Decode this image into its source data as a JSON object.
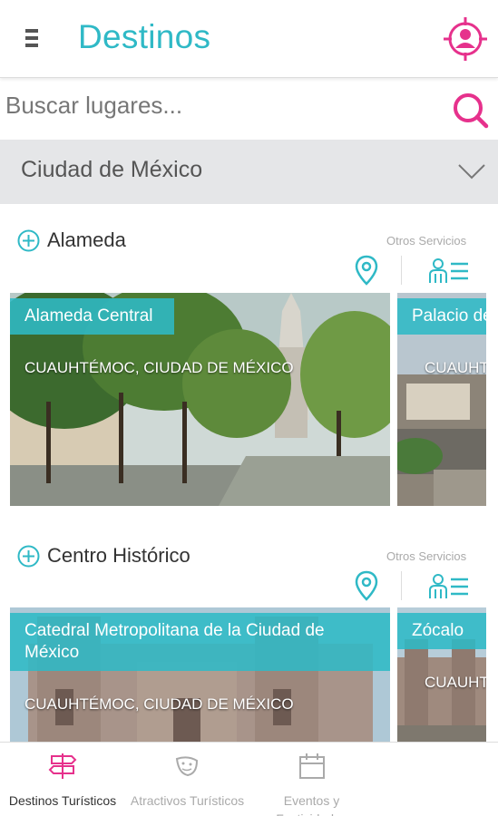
{
  "header": {
    "title": "Destinos",
    "menu_icon": "hamburger-menu-icon",
    "profile_icon": "user-target-icon"
  },
  "search": {
    "placeholder": "Buscar lugares...",
    "value": ""
  },
  "city_select": {
    "selected": "Ciudad de México"
  },
  "sections": [
    {
      "title": "Alameda",
      "otros_label": "Otros Servicios",
      "cards": [
        {
          "title": "Alameda Central",
          "subtitle": "CUAUHTÉMOC, CIUDAD DE MÉXICO"
        },
        {
          "title": "Palacio de",
          "subtitle": "CUAUHTÉMOC"
        }
      ]
    },
    {
      "title": "Centro Histórico",
      "otros_label": "Otros Servicios",
      "cards": [
        {
          "title": "Catedral Metropolitana de la Ciudad de México",
          "subtitle": "CUAUHTÉMOC, CIUDAD DE MÉXICO"
        },
        {
          "title": "Zócalo",
          "subtitle": "CUAUHTÉMOC"
        }
      ]
    }
  ],
  "bottom_nav": [
    {
      "label": "Destinos Turísticos",
      "active": true
    },
    {
      "label": "Atractivos Turísticos",
      "active": false
    },
    {
      "label": "Eventos y Festividades",
      "active": false
    }
  ],
  "colors": {
    "accent": "#2fb9c6",
    "brand_pink": "#e6318c",
    "inactive": "#aaaaaa"
  }
}
